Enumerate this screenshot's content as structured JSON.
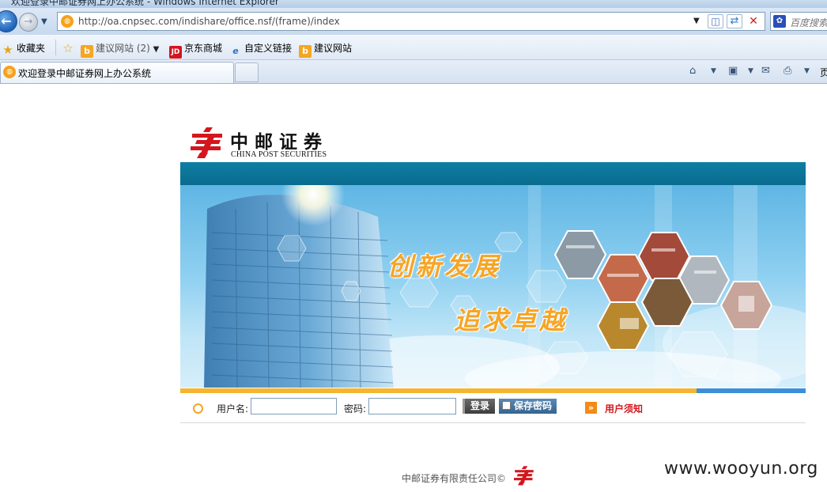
{
  "browser": {
    "window_title": "欢迎登录中邮证券网上办公系统 - Windows Internet Explorer",
    "url": "http://oa.cnpsec.com/indishare/office.nsf/(frame)/index",
    "search_placeholder": "百度搜索",
    "favorites": {
      "label": "收藏夹",
      "items": [
        {
          "label": "建议网站 (2)",
          "icon": "bing-icon"
        },
        {
          "label": "京东商城",
          "icon": "jd-icon"
        },
        {
          "label": "自定义链接",
          "icon": "ie-page-icon"
        },
        {
          "label": "建议网站",
          "icon": "bing-icon"
        }
      ]
    },
    "tab_title": "欢迎登录中邮证券网上办公系统",
    "page_menu_label": "页"
  },
  "page": {
    "logo_cn": "中邮证券",
    "logo_en": "CHINA POST SECURITIES",
    "slogan_1": "创新发展",
    "slogan_2": "追求卓越",
    "login": {
      "username_label": "用户名:",
      "username_value": "",
      "password_label": "密码:",
      "password_value": "",
      "login_button": "登录",
      "save_password_label": "保存密码",
      "notice_link": "用户须知"
    },
    "footer": "中邮证券有限责任公司©",
    "watermark": "www.wooyun.org"
  },
  "colors": {
    "brand_red": "#d4161d",
    "banner_teal": "#0e7ea3",
    "accent_orange": "#f5b532",
    "accent_blue": "#3d8fd9"
  }
}
